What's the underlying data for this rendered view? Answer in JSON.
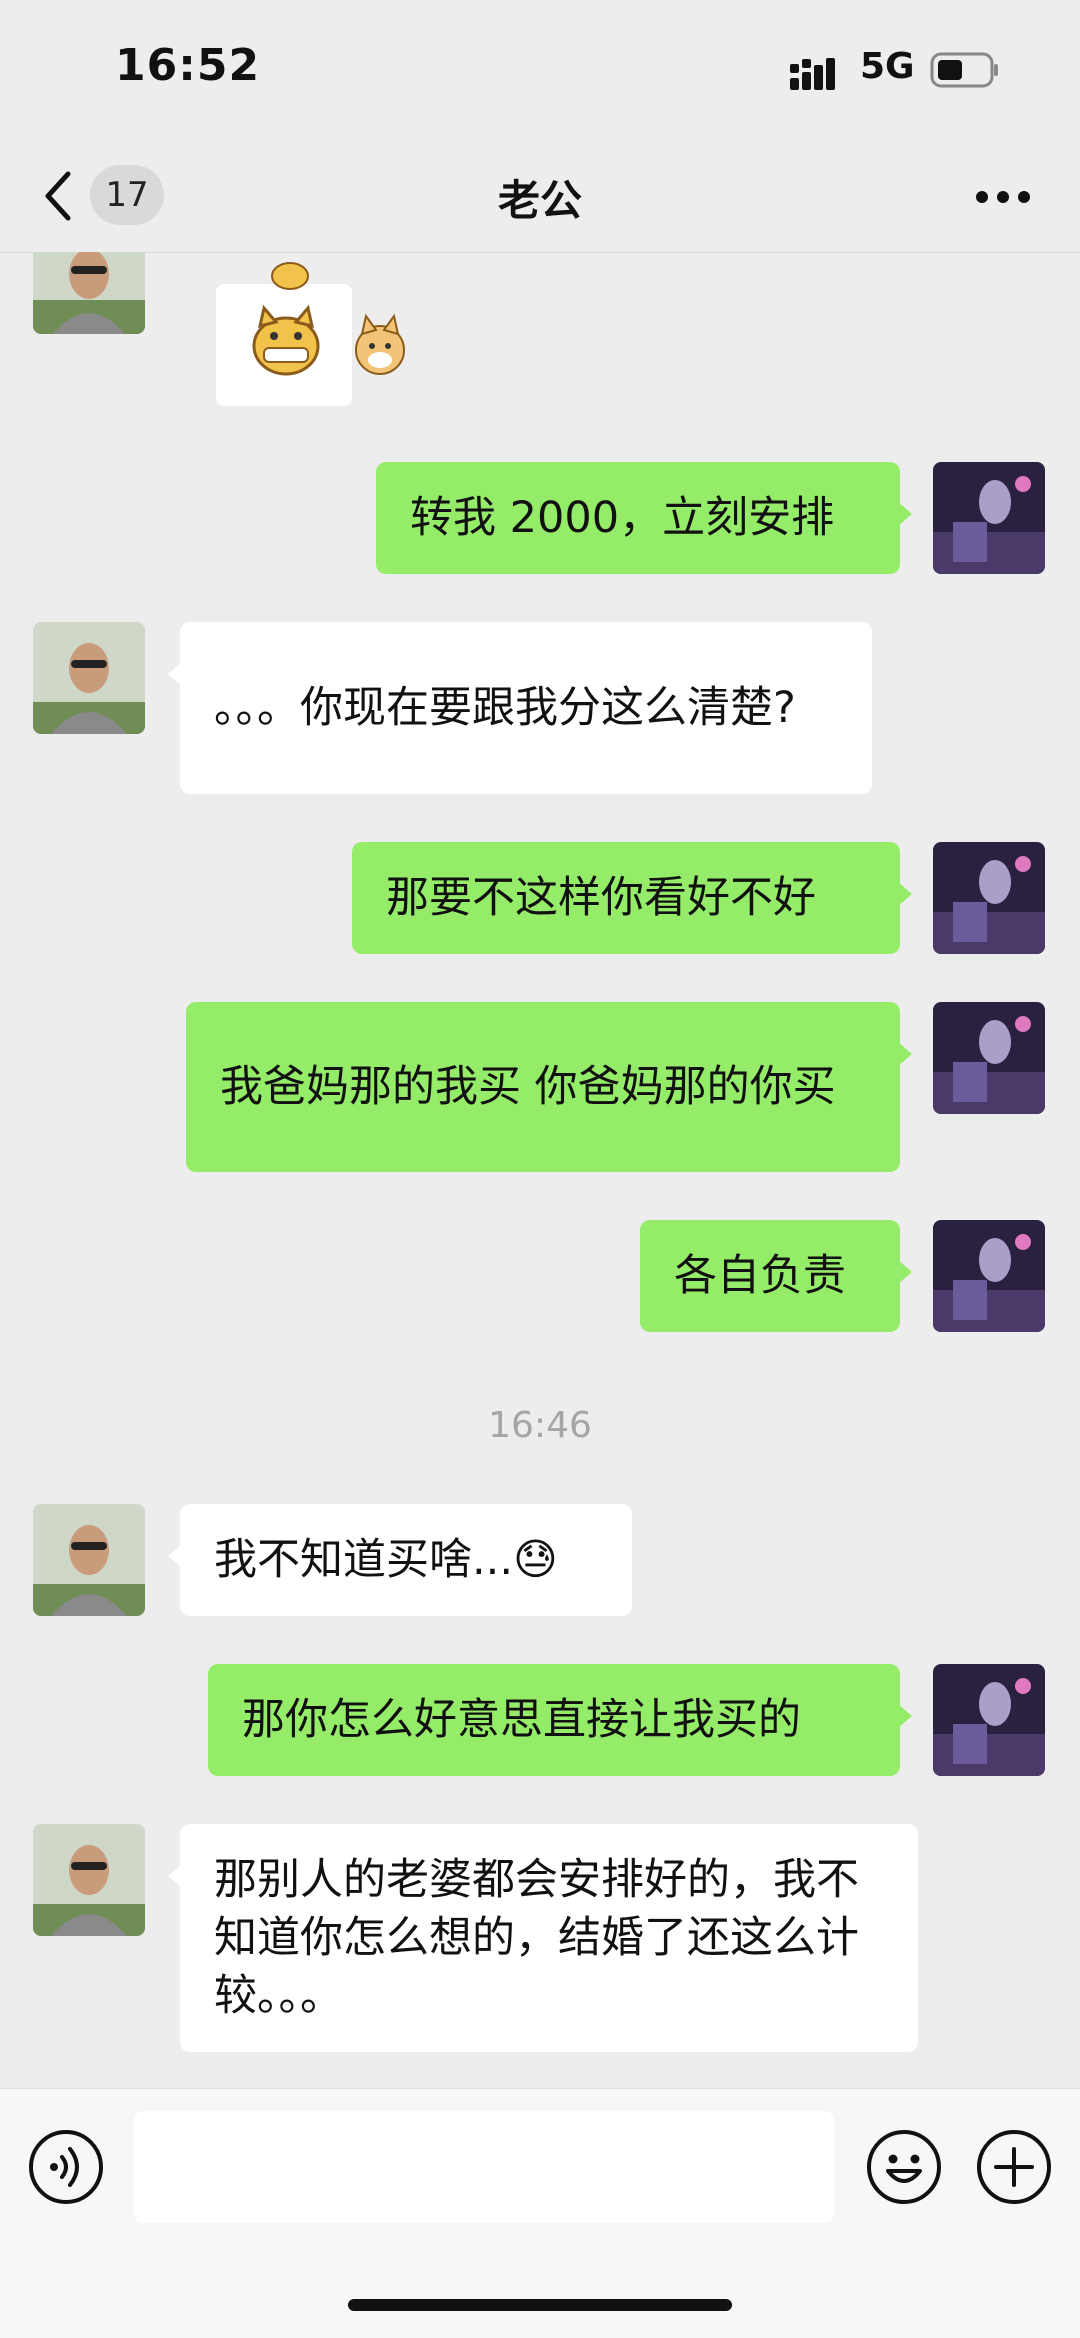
{
  "status_bar": {
    "time": "16:52",
    "network": "5G"
  },
  "nav": {
    "unread_count": "17",
    "title": "老公"
  },
  "messages": [
    {
      "side": "them",
      "type": "sticker",
      "sticker": "cat-and-doge-laughing-sticker"
    },
    {
      "side": "me",
      "text": "转我 2000，立刻安排"
    },
    {
      "side": "them",
      "text": "。。。你现在要跟我分这么清楚?"
    },
    {
      "side": "me",
      "text": "那要不这样你看好不好"
    },
    {
      "side": "me",
      "text": "我爸妈那的我买  你爸妈那的你买"
    },
    {
      "side": "me",
      "text": "各自负责"
    },
    {
      "type": "timestamp",
      "text": "16:46"
    },
    {
      "side": "them",
      "text": "我不知道买啥...😓"
    },
    {
      "side": "me",
      "text": "那你怎么好意思直接让我买的"
    },
    {
      "side": "them",
      "text": "那别人的老婆都会安排好的，我不知道你怎么想的，结婚了还这么计较。。。"
    }
  ],
  "input_bar": {
    "draft": ""
  },
  "colors": {
    "my_bubble": "#95ec69",
    "their_bubble": "#ffffff",
    "background": "#ededed"
  }
}
